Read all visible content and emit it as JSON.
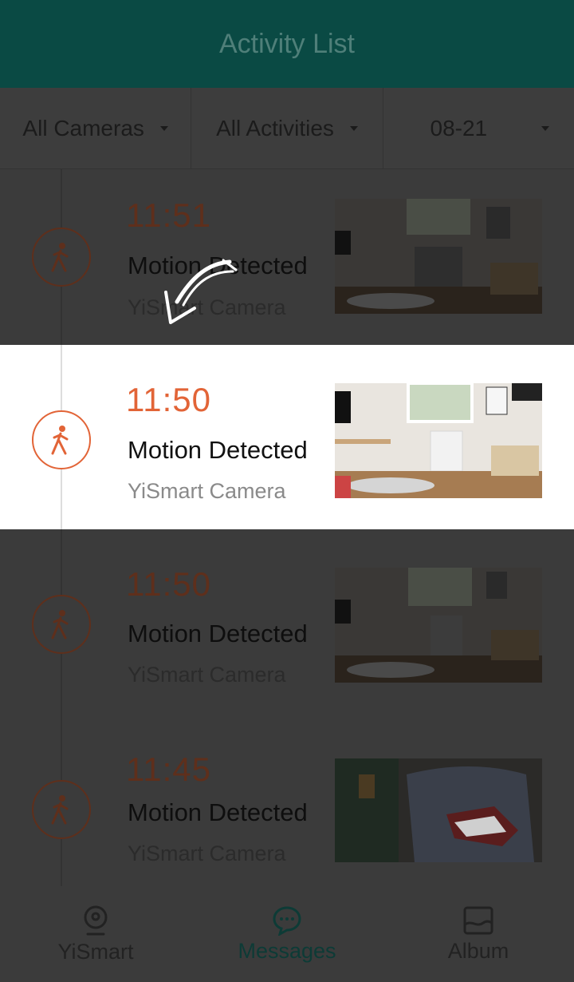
{
  "header": {
    "title": "Activity List"
  },
  "filters": {
    "camera": "All Cameras",
    "activity": "All Activities",
    "date": "08-21"
  },
  "activities": [
    {
      "time": "11:51",
      "event": "Motion Detected",
      "camera": "YiSmart Camera"
    },
    {
      "time": "11:50",
      "event": "Motion Detected",
      "camera": "YiSmart Camera"
    },
    {
      "time": "11:50",
      "event": "Motion Detected",
      "camera": "YiSmart Camera"
    },
    {
      "time": "11:45",
      "event": "Motion Detected",
      "camera": "YiSmart Camera"
    }
  ],
  "tabs": {
    "home": "YiSmart",
    "messages": "Messages",
    "album": "Album"
  },
  "colors": {
    "header": "#0a4a44",
    "accent": "#e26437",
    "active_tab": "#0d3b36"
  },
  "icons": [
    "walking-person-icon",
    "camera-icon",
    "chat-bubble-icon",
    "image-icon",
    "caret-down-icon"
  ]
}
